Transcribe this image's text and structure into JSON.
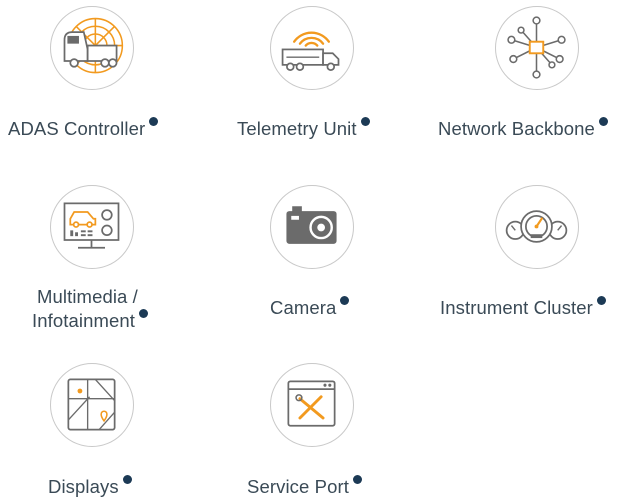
{
  "colors": {
    "accent": "#f29a1f",
    "icon": "#6b6b6b",
    "dot": "#1c3a55",
    "ring": "#c9c9c9"
  },
  "items": [
    {
      "label": "ADAS Controller",
      "icon": "truck-radar-icon"
    },
    {
      "label": "Telemetry Unit",
      "icon": "truck-signal-icon"
    },
    {
      "label": "Network Backbone",
      "icon": "network-hub-icon"
    },
    {
      "label_line1": "Multimedia /",
      "label_line2": "Infotainment",
      "icon": "monitor-car-icon"
    },
    {
      "label": "Camera",
      "icon": "camera-icon"
    },
    {
      "label": "Instrument Cluster",
      "icon": "gauges-icon"
    },
    {
      "label": "Displays",
      "icon": "map-display-icon"
    },
    {
      "label": "Service Port",
      "icon": "tools-window-icon"
    }
  ]
}
